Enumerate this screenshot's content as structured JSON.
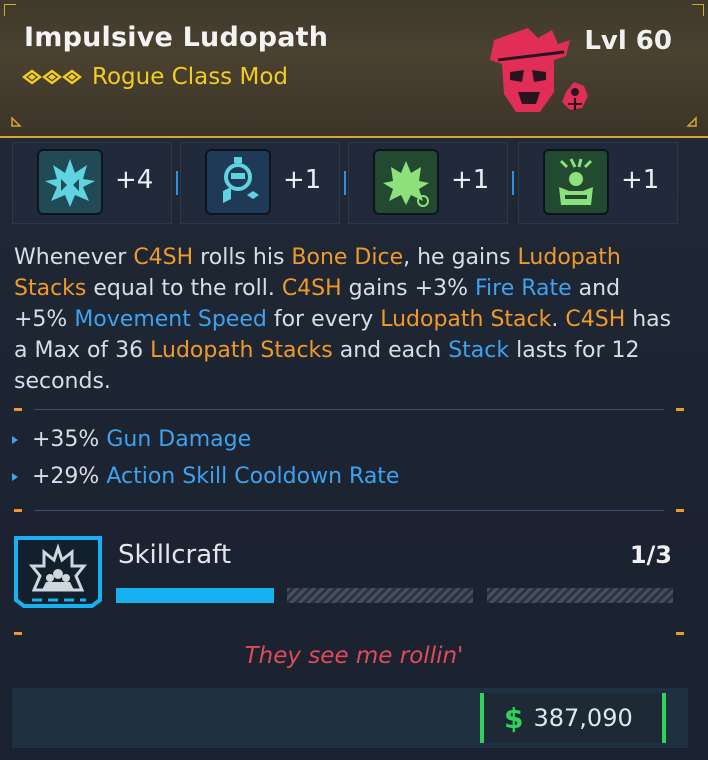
{
  "header": {
    "title": "Impulsive Ludopath",
    "subtitle": "Rogue Class Mod",
    "level": "Lvl 60",
    "rarity_color": "#f1cd22",
    "character_icon": "c4sh-skull-icon"
  },
  "skills": [
    {
      "icon": "rogue-skill-icon",
      "bonus": "+4",
      "color": "#1f4a56"
    },
    {
      "icon": "dice-skill-icon",
      "bonus": "+1",
      "color": "#1f3a56"
    },
    {
      "icon": "leaf-skill-icon",
      "bonus": "+1",
      "color": "#224a30"
    },
    {
      "icon": "hand-skill-icon",
      "bonus": "+1",
      "color": "#224a30"
    }
  ],
  "description": {
    "p1": "Whenever ",
    "k1": "C4SH",
    "p2": " rolls his ",
    "k2": "Bone Dice",
    "p3": ", he gains ",
    "k3": "Ludopath Stacks",
    "p4": " equal to the roll. ",
    "k4": "C4SH",
    "p5": " gains +3% ",
    "k5": "Fire Rate",
    "p6": " and +5% ",
    "k6": "Movement Speed",
    "p7": " for every ",
    "k7": "Ludopath Stack",
    "p8": ". ",
    "k8": "C4SH",
    "p9": " has a Max of 36 ",
    "k9": "Ludopath Stacks",
    "p10": " and each ",
    "k10": "Stack",
    "p11": " lasts for 12 seconds."
  },
  "stats": [
    {
      "value": "+35%",
      "name": "Gun Damage"
    },
    {
      "value": "+29%",
      "name": "Action Skill Cooldown Rate"
    }
  ],
  "skillcraft": {
    "label": "Skillcraft",
    "count": "1/3",
    "progress": 0.3333,
    "bar_color": "#17b0f0"
  },
  "quote": "They see me rollin'",
  "footer": {
    "currency_symbol": "$",
    "amount": "387,090",
    "currency_color": "#2fd25a"
  }
}
